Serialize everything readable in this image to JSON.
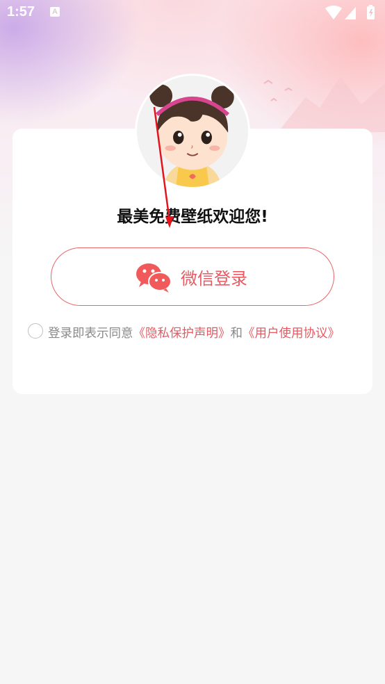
{
  "status_bar": {
    "time": "1:57",
    "notification_icon": "a-icon",
    "wifi_icon": "wifi-icon",
    "signal_icon": "signal-icon",
    "battery_icon": "battery-icon"
  },
  "avatar": {
    "icon": "cartoon-girl-avatar"
  },
  "login": {
    "welcome_title": "最美免费壁纸欢迎您!",
    "wechat_button_label": "微信登录",
    "wechat_icon": "wechat-icon",
    "accent_color": "#e85a62"
  },
  "agreement": {
    "prefix": "登录即表示同意",
    "privacy_link": "《隐私保护声明》",
    "conjunction": "和",
    "terms_link": "《用户使用协议》",
    "checked": false
  }
}
